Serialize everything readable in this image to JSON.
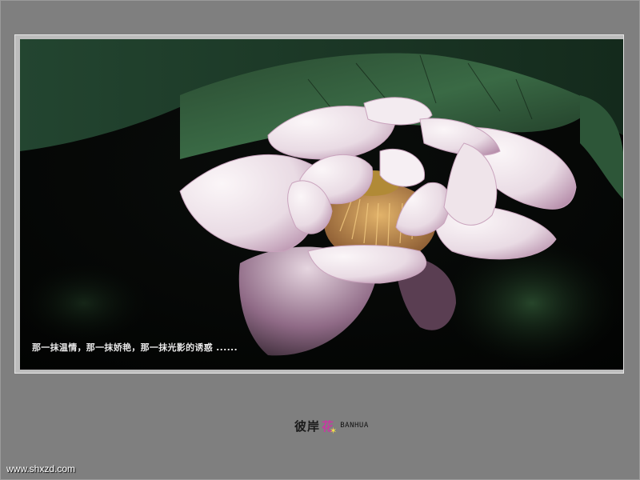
{
  "photo": {
    "caption": "那一抹温情，那一抹娇艳，那一抹光影的诱惑 ......",
    "subject": "lotus-flower-on-dark-leaf"
  },
  "logo": {
    "text": "彼岸",
    "flower_glyph": "花",
    "latin": "BANHUA"
  },
  "watermark": {
    "url": "www.shxzd.com"
  },
  "colors": {
    "background": "#7f7f7f",
    "mat": "#bdbdbd",
    "petal": "#f1e6ec",
    "petal_edge": "#c9a3bd",
    "leaf": "#2f5a3a",
    "stamen": "#c9a070"
  }
}
